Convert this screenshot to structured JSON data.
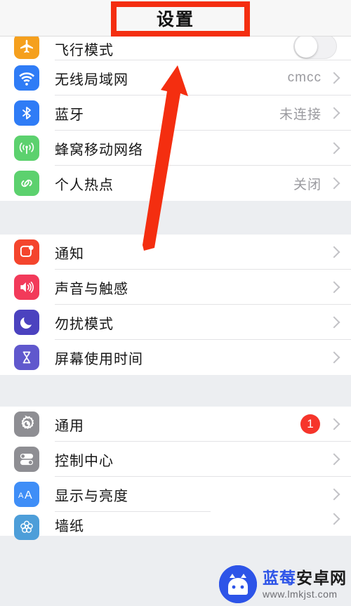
{
  "navbar": {
    "title": "设置"
  },
  "groups": [
    {
      "id": "connectivity",
      "rows": [
        {
          "name": "airplane-mode",
          "label": "飞行模式",
          "icon": "airplane-icon",
          "icon_color": "#f5a01e",
          "accessory": "toggle",
          "toggle_on": false,
          "clipped": "top"
        },
        {
          "name": "wifi",
          "label": "无线局域网",
          "icon": "wifi-icon",
          "icon_color": "#2f7cf6",
          "accessory": "value",
          "value": "cmcc"
        },
        {
          "name": "bluetooth",
          "label": "蓝牙",
          "icon": "bluetooth-icon",
          "icon_color": "#2f7cf6",
          "accessory": "value",
          "value": "未连接"
        },
        {
          "name": "cellular",
          "label": "蜂窝移动网络",
          "icon": "cellular-icon",
          "icon_color": "#5cd16e",
          "accessory": "chevron",
          "value": ""
        },
        {
          "name": "personal-hotspot",
          "label": "个人热点",
          "icon": "hotspot-icon",
          "icon_color": "#5cd16e",
          "accessory": "value",
          "value": "关闭"
        }
      ]
    },
    {
      "id": "alerts",
      "rows": [
        {
          "name": "notifications",
          "label": "通知",
          "icon": "notification-icon",
          "icon_color": "#f4452d",
          "accessory": "chevron",
          "value": ""
        },
        {
          "name": "sounds-haptics",
          "label": "声音与触感",
          "icon": "speaker-icon",
          "icon_color": "#f23a5a",
          "accessory": "chevron",
          "value": ""
        },
        {
          "name": "do-not-disturb",
          "label": "勿扰模式",
          "icon": "moon-icon",
          "icon_color": "#4b42bf",
          "accessory": "chevron",
          "value": ""
        },
        {
          "name": "screen-time",
          "label": "屏幕使用时间",
          "icon": "hourglass-icon",
          "icon_color": "#6058cd",
          "accessory": "chevron",
          "value": ""
        }
      ]
    },
    {
      "id": "system",
      "rows": [
        {
          "name": "general",
          "label": "通用",
          "icon": "gear-icon",
          "icon_color": "#8e8e93",
          "accessory": "badge",
          "badge": "1"
        },
        {
          "name": "control-center",
          "label": "控制中心",
          "icon": "toggles-icon",
          "icon_color": "#8e8e93",
          "accessory": "chevron",
          "value": ""
        },
        {
          "name": "display-brightness",
          "label": "显示与亮度",
          "icon": "aa-icon",
          "icon_color": "#3f8ef7",
          "accessory": "chevron",
          "value": ""
        },
        {
          "name": "wallpaper",
          "label": "墙纸",
          "icon": "wallpaper-icon",
          "icon_color": "#4d9ed9",
          "accessory": "chevron",
          "value": "",
          "clipped": "bottom"
        }
      ]
    }
  ],
  "annotation": {
    "highlight_color": "#f42e10",
    "arrow_color": "#f42e10",
    "target": "设置"
  },
  "watermark": {
    "brand_blue": "蓝莓",
    "brand_dark": "安卓网",
    "url": "www.lmkjst.com",
    "logo_color": "#2d54e8"
  }
}
